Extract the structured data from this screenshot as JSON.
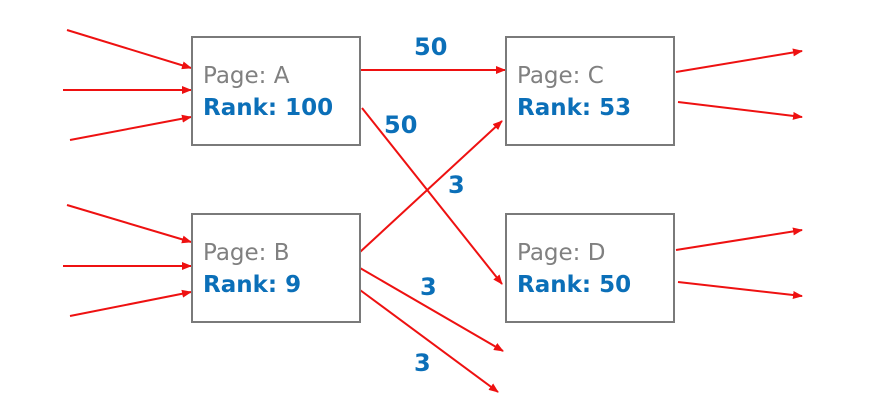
{
  "nodes": {
    "a": {
      "title": "Page: A",
      "rank": "Rank: 100"
    },
    "b": {
      "title": "Page: B",
      "rank": "Rank: 9"
    },
    "c": {
      "title": "Page: C",
      "rank": "Rank: 53"
    },
    "d": {
      "title": "Page: D",
      "rank": "Rank: 50"
    }
  },
  "edge_labels": {
    "a_to_c": "50",
    "a_to_d": "50",
    "b_to_c": "3",
    "b_out_1": "3",
    "b_out_2": "3"
  },
  "colors": {
    "arrow": "#ee1111",
    "rank_text": "#0b6fb8",
    "title_text": "#808080",
    "box_border": "#7a7a7a"
  }
}
